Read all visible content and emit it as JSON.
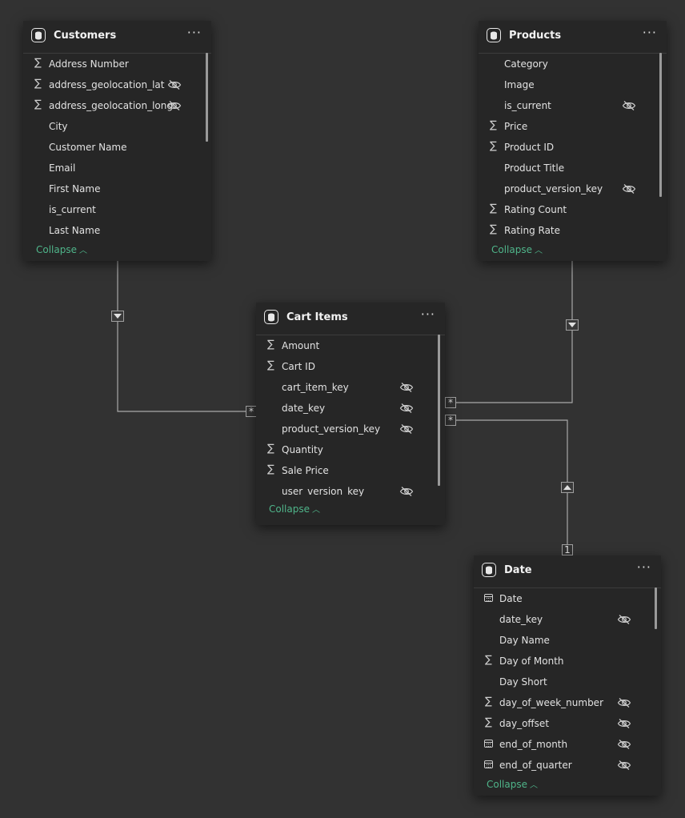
{
  "tables": {
    "customers": {
      "title": "Customers",
      "more": "···",
      "collapse": "Collapse",
      "fields": [
        {
          "name": "Address Number",
          "icon": "sigma",
          "hidden": false
        },
        {
          "name": "address_geolocation_lat",
          "icon": "sigma",
          "hidden": true
        },
        {
          "name": "address_geolocation_long",
          "icon": "sigma",
          "hidden": true
        },
        {
          "name": "City",
          "icon": "none",
          "hidden": false
        },
        {
          "name": "Customer Name",
          "icon": "none",
          "hidden": false
        },
        {
          "name": "Email",
          "icon": "none",
          "hidden": false
        },
        {
          "name": "First Name",
          "icon": "none",
          "hidden": false
        },
        {
          "name": "is_current",
          "icon": "none",
          "hidden": false
        },
        {
          "name": "Last Name",
          "icon": "none",
          "hidden": false
        }
      ]
    },
    "products": {
      "title": "Products",
      "more": "···",
      "collapse": "Collapse",
      "fields": [
        {
          "name": "Category",
          "icon": "none",
          "hidden": false
        },
        {
          "name": "Image",
          "icon": "none",
          "hidden": false
        },
        {
          "name": "is_current",
          "icon": "none",
          "hidden": true
        },
        {
          "name": "Price",
          "icon": "sigma",
          "hidden": false
        },
        {
          "name": "Product ID",
          "icon": "sigma",
          "hidden": false
        },
        {
          "name": "Product Title",
          "icon": "none",
          "hidden": false
        },
        {
          "name": "product_version_key",
          "icon": "none",
          "hidden": true
        },
        {
          "name": "Rating Count",
          "icon": "sigma",
          "hidden": false
        },
        {
          "name": "Rating Rate",
          "icon": "sigma",
          "hidden": false
        }
      ]
    },
    "cart_items": {
      "title": "Cart Items",
      "more": "···",
      "collapse": "Collapse",
      "fields": [
        {
          "name": "Amount",
          "icon": "sigma",
          "hidden": false
        },
        {
          "name": "Cart ID",
          "icon": "sigma",
          "hidden": false
        },
        {
          "name": "cart_item_key",
          "icon": "none",
          "hidden": true
        },
        {
          "name": "date_key",
          "icon": "none",
          "hidden": true
        },
        {
          "name": "product_version_key",
          "icon": "none",
          "hidden": true
        },
        {
          "name": "Quantity",
          "icon": "sigma",
          "hidden": false
        },
        {
          "name": "Sale Price",
          "icon": "sigma",
          "hidden": false
        },
        {
          "name": "user_version_key",
          "icon": "none",
          "hidden": true
        }
      ]
    },
    "date": {
      "title": "Date",
      "more": "···",
      "collapse": "Collapse",
      "fields": [
        {
          "name": "Date",
          "icon": "calendar",
          "hidden": false
        },
        {
          "name": "date_key",
          "icon": "none",
          "hidden": true
        },
        {
          "name": "Day Name",
          "icon": "none",
          "hidden": false
        },
        {
          "name": "Day of Month",
          "icon": "sigma",
          "hidden": false
        },
        {
          "name": "Day Short",
          "icon": "none",
          "hidden": false
        },
        {
          "name": "day_of_week_number",
          "icon": "sigma",
          "hidden": true
        },
        {
          "name": "day_offset",
          "icon": "sigma",
          "hidden": true
        },
        {
          "name": "end_of_month",
          "icon": "calendar",
          "hidden": true
        },
        {
          "name": "end_of_quarter",
          "icon": "calendar",
          "hidden": true
        }
      ]
    }
  },
  "relationships": [
    {
      "from": "Customers",
      "to": "Cart Items",
      "from_card": "",
      "to_card": "*"
    },
    {
      "from": "Products",
      "to": "Cart Items",
      "from_card": "",
      "to_card": "*"
    },
    {
      "from": "Date",
      "to": "Cart Items",
      "from_card": "1",
      "to_card": "*"
    }
  ],
  "icons": {
    "sigma": "∑",
    "table": "database-icon",
    "hidden": "eye-off-icon"
  },
  "colors": {
    "background": "#323232",
    "card": "#262626",
    "collapse": "#4fb58a",
    "line": "#a8a8a8"
  }
}
